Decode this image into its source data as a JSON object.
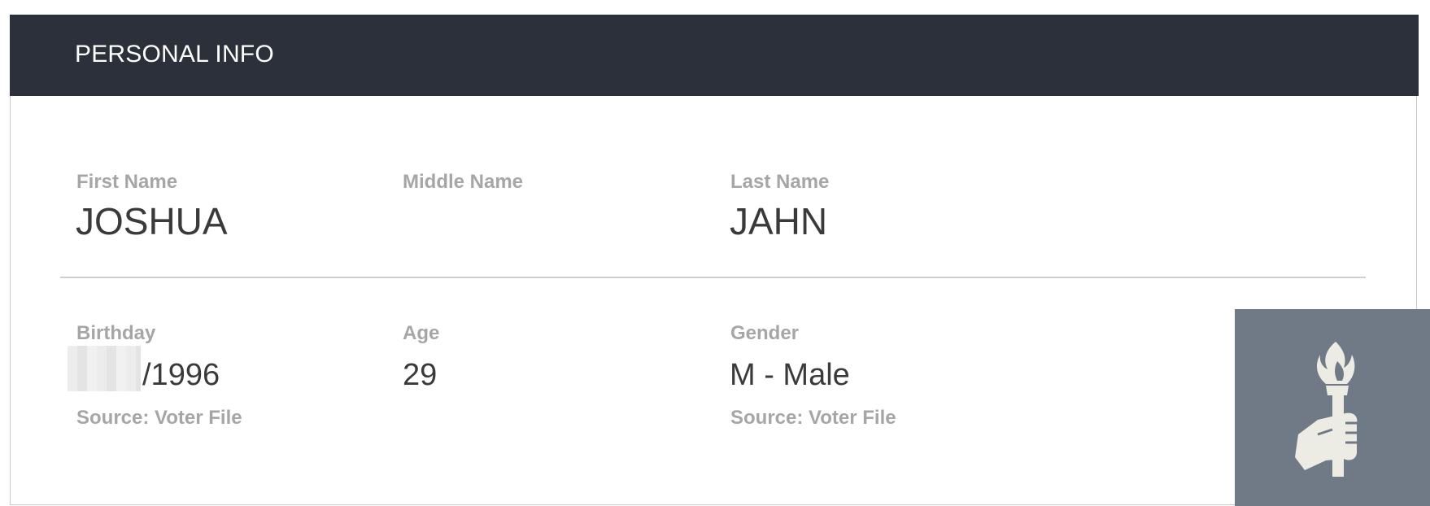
{
  "header": {
    "title": "PERSONAL INFO"
  },
  "fields": {
    "first_name": {
      "label": "First Name",
      "value": "JOSHUA"
    },
    "middle_name": {
      "label": "Middle Name",
      "value": ""
    },
    "last_name": {
      "label": "Last Name",
      "value": "JAHN"
    },
    "birthday": {
      "label": "Birthday",
      "value": "/1996",
      "source": "Source: Voter File"
    },
    "age": {
      "label": "Age",
      "value": "29"
    },
    "gender": {
      "label": "Gender",
      "value": "M - Male",
      "source": "Source: Voter File"
    }
  },
  "badge": {
    "icon": "torch-icon",
    "background": "#707a86",
    "icon_color": "#ecebe4"
  },
  "colors": {
    "header_bg": "#2b303b",
    "label": "#a6a6a6",
    "value": "#3a3a3a"
  }
}
